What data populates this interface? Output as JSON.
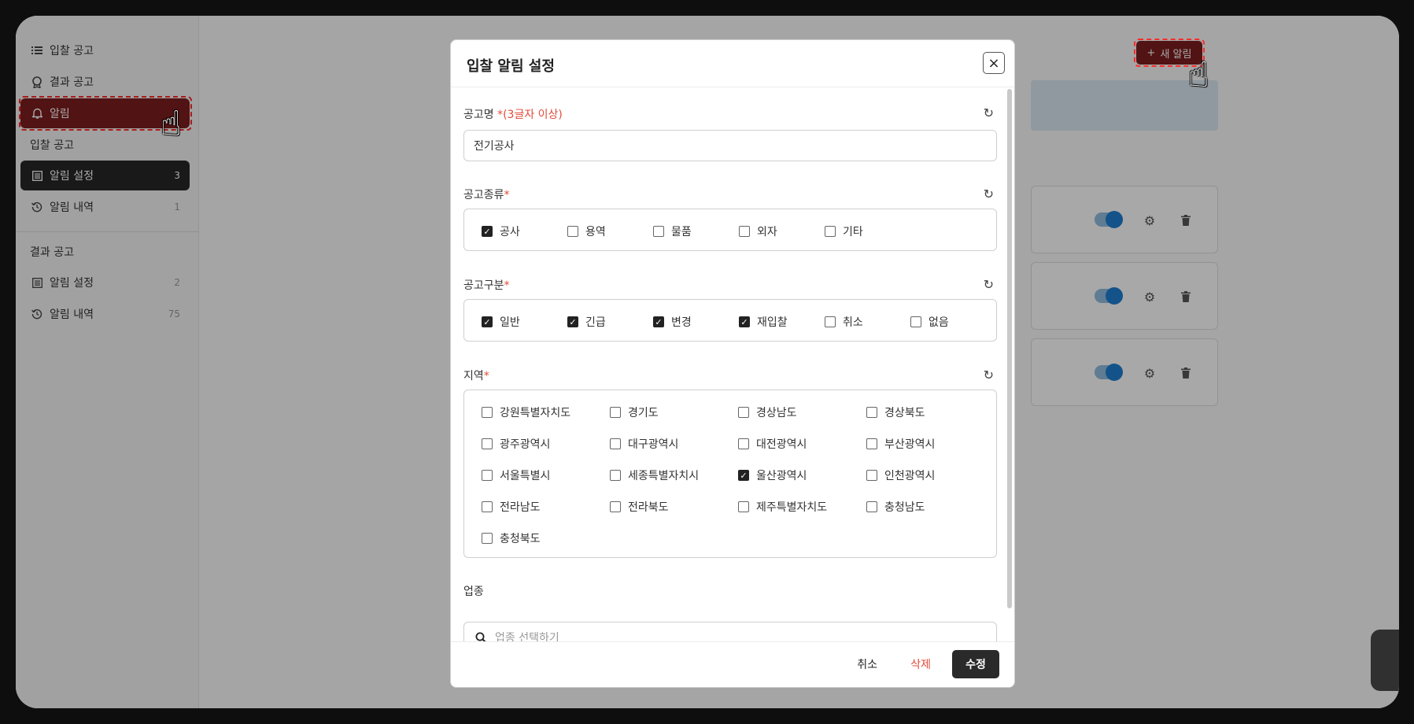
{
  "sidebar": {
    "top_items": [
      {
        "label": "입찰 공고",
        "icon": "list-icon"
      },
      {
        "label": "결과 공고",
        "icon": "award-icon"
      },
      {
        "label": "알림",
        "icon": "bell-icon"
      }
    ],
    "sections": [
      {
        "title": "입찰 공고",
        "items": [
          {
            "label": "알림 설정",
            "count": "3",
            "icon": "settings-list-icon"
          },
          {
            "label": "알림 내역",
            "count": "1",
            "icon": "history-icon"
          }
        ]
      },
      {
        "title": "결과 공고",
        "items": [
          {
            "label": "알림 설정",
            "count": "2",
            "icon": "settings-list-icon"
          },
          {
            "label": "알림 내역",
            "count": "75",
            "icon": "history-icon"
          }
        ]
      }
    ]
  },
  "main": {
    "new_alarm_label": "새 알림",
    "new_alarm_plus": "+"
  },
  "modal": {
    "title": "입찰 알림 설정",
    "close_icon": "×",
    "name_field": {
      "label": "공고명",
      "required_hint": "*(3글자 이상)",
      "value": "전기공사"
    },
    "type_field": {
      "label": "공고종류",
      "required": "*",
      "options": [
        {
          "label": "공사",
          "checked": true
        },
        {
          "label": "용역",
          "checked": false
        },
        {
          "label": "물품",
          "checked": false
        },
        {
          "label": "외자",
          "checked": false
        },
        {
          "label": "기타",
          "checked": false
        }
      ]
    },
    "category_field": {
      "label": "공고구분",
      "required": "*",
      "options": [
        {
          "label": "일반",
          "checked": true
        },
        {
          "label": "긴급",
          "checked": true
        },
        {
          "label": "변경",
          "checked": true
        },
        {
          "label": "재입찰",
          "checked": true
        },
        {
          "label": "취소",
          "checked": false
        },
        {
          "label": "없음",
          "checked": false
        }
      ]
    },
    "region_field": {
      "label": "지역",
      "required": "*",
      "options": [
        {
          "label": "강원특별자치도",
          "checked": false
        },
        {
          "label": "경기도",
          "checked": false
        },
        {
          "label": "경상남도",
          "checked": false
        },
        {
          "label": "경상북도",
          "checked": false
        },
        {
          "label": "광주광역시",
          "checked": false
        },
        {
          "label": "대구광역시",
          "checked": false
        },
        {
          "label": "대전광역시",
          "checked": false
        },
        {
          "label": "부산광역시",
          "checked": false
        },
        {
          "label": "서울특별시",
          "checked": false
        },
        {
          "label": "세종특별자치시",
          "checked": false
        },
        {
          "label": "울산광역시",
          "checked": true
        },
        {
          "label": "인천광역시",
          "checked": false
        },
        {
          "label": "전라남도",
          "checked": false
        },
        {
          "label": "전라북도",
          "checked": false
        },
        {
          "label": "제주특별자치도",
          "checked": false
        },
        {
          "label": "충청남도",
          "checked": false
        },
        {
          "label": "충청북도",
          "checked": false
        }
      ]
    },
    "industry_field": {
      "label": "업종",
      "placeholder": "업종 선택하기"
    },
    "footer": {
      "cancel_label": "취소",
      "delete_label": "삭제",
      "submit_label": "수정"
    }
  },
  "colors": {
    "accent_red": "#7b1d1d",
    "required_red": "#e34b3a",
    "toggle_blue": "#1d7fd0"
  }
}
